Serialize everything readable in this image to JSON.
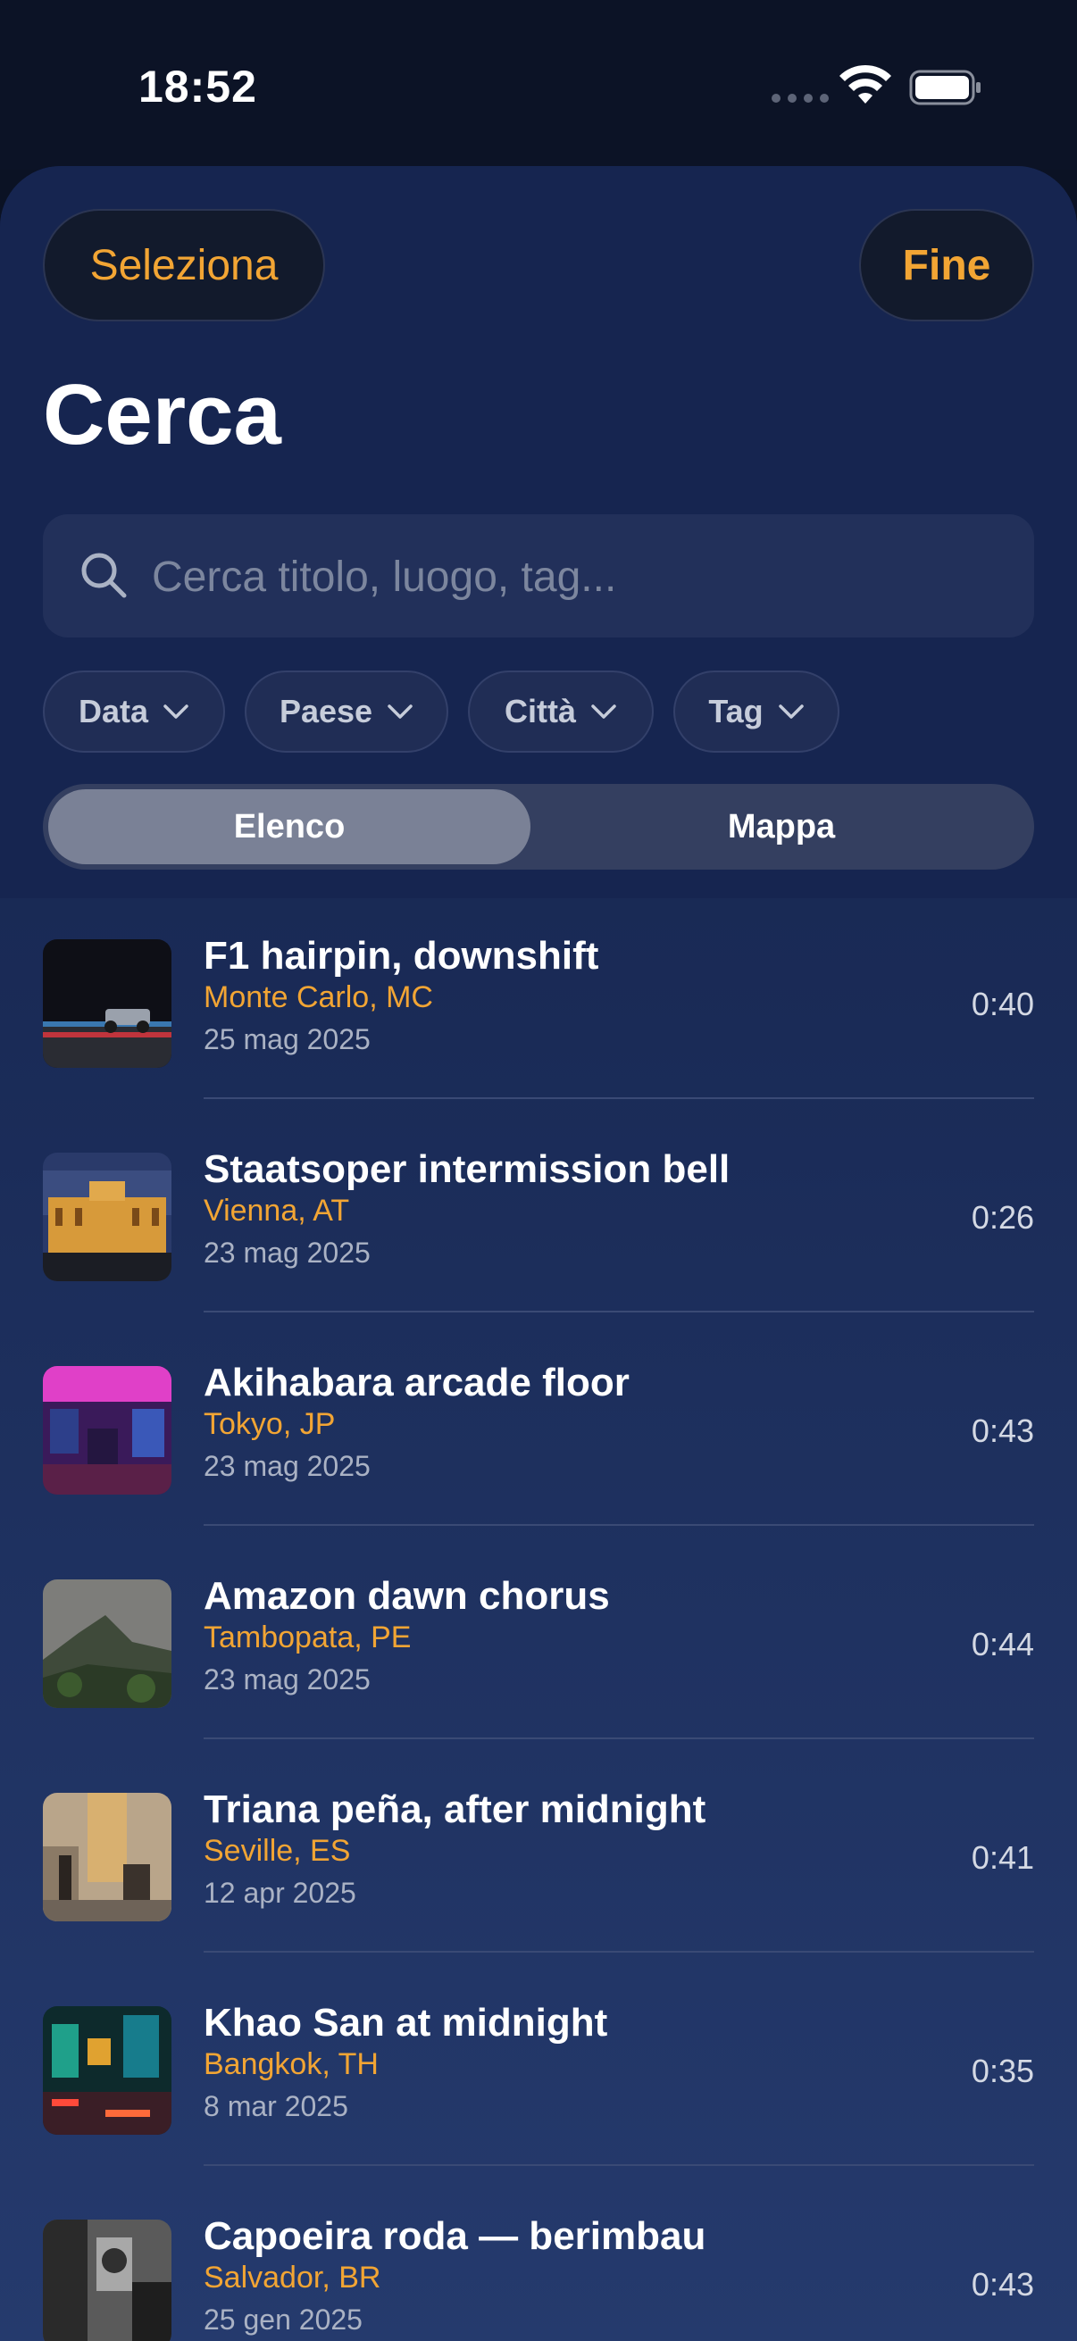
{
  "status_bar": {
    "time": "18:52"
  },
  "toolbar": {
    "select_label": "Seleziona",
    "done_label": "Fine"
  },
  "page": {
    "title": "Cerca"
  },
  "search": {
    "placeholder": "Cerca titolo, luogo, tag..."
  },
  "filters": [
    {
      "label": "Data"
    },
    {
      "label": "Paese"
    },
    {
      "label": "Città"
    },
    {
      "label": "Tag"
    }
  ],
  "view_toggle": {
    "list_label": "Elenco",
    "map_label": "Mappa",
    "selected": "Elenco"
  },
  "recordings": [
    {
      "title": "F1 hairpin, downshift",
      "place": "Monte Carlo, MC",
      "date": "25 mag 2025",
      "duration": "0:40"
    },
    {
      "title": "Staatsoper intermission bell",
      "place": "Vienna, AT",
      "date": "23 mag 2025",
      "duration": "0:26"
    },
    {
      "title": "Akihabara arcade floor",
      "place": "Tokyo, JP",
      "date": "23 mag 2025",
      "duration": "0:43"
    },
    {
      "title": "Amazon dawn chorus",
      "place": "Tambopata, PE",
      "date": "23 mag 2025",
      "duration": "0:44"
    },
    {
      "title": "Triana peña, after midnight",
      "place": "Seville, ES",
      "date": "12 apr 2025",
      "duration": "0:41"
    },
    {
      "title": "Khao San at midnight",
      "place": "Bangkok, TH",
      "date": "8 mar 2025",
      "duration": "0:35"
    },
    {
      "title": "Capoeira roda — berimbau",
      "place": "Salvador, BR",
      "date": "25 gen 2025",
      "duration": "0:43"
    }
  ],
  "colors": {
    "accent": "#f2a534",
    "background": "#1a2b57"
  },
  "icons": [
    "signal-icon",
    "wifi-icon",
    "battery-icon",
    "search-icon",
    "chevron-down-icon"
  ]
}
